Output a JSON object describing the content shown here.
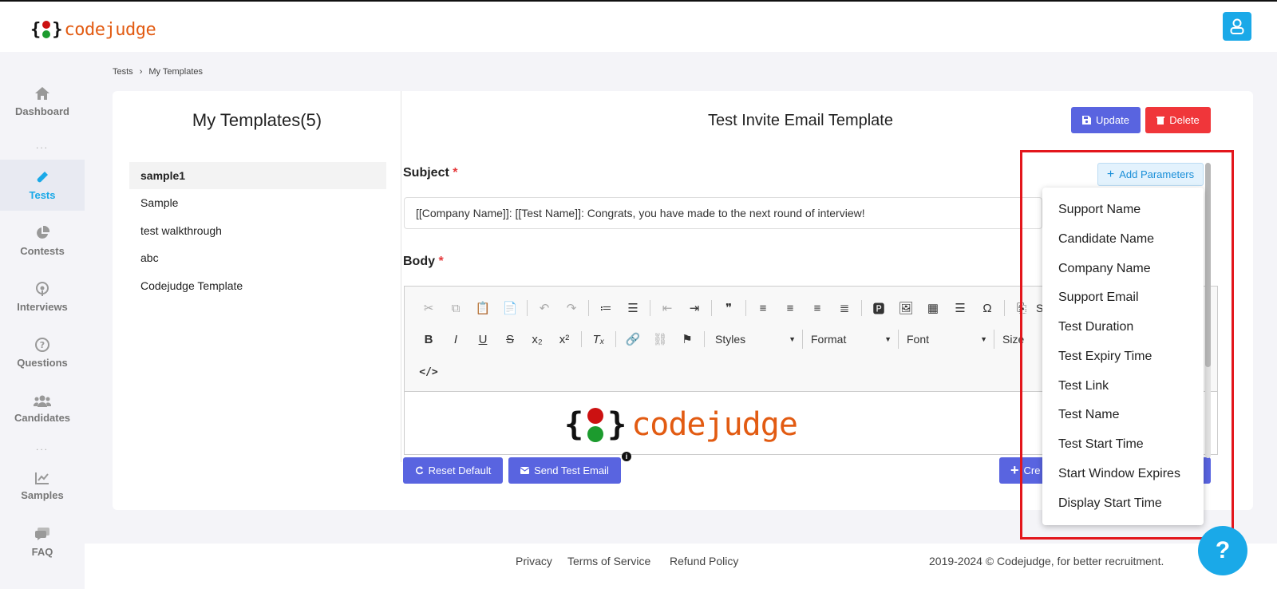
{
  "brand": {
    "name": "codejudge",
    "colors": {
      "accent": "#1aa9e8",
      "brand_orange": "#e25b12",
      "dot_red": "#cc1111",
      "dot_green": "#1c9b2e",
      "primary_button": "#5964e0",
      "danger_button": "#f0363a"
    }
  },
  "sidebar": {
    "items": [
      {
        "label": "Dashboard",
        "icon": "home-icon"
      },
      {
        "label": "Tests",
        "icon": "flask-icon"
      },
      {
        "label": "Contests",
        "icon": "pie-chart-icon"
      },
      {
        "label": "Interviews",
        "icon": "podcast-icon"
      },
      {
        "label": "Questions",
        "icon": "question-circle-icon"
      },
      {
        "label": "Candidates",
        "icon": "users-icon"
      },
      {
        "label": "Samples",
        "icon": "line-chart-icon"
      },
      {
        "label": "FAQ",
        "icon": "chat-icon"
      }
    ],
    "separator": "...",
    "active": "Tests"
  },
  "breadcrumb": {
    "root": "Tests",
    "separator": "›",
    "current": "My Templates"
  },
  "templates": {
    "title": "My Templates(5)",
    "items": [
      "sample1",
      "Sample",
      "test walkthrough",
      "abc",
      "Codejudge Template"
    ],
    "selected": "sample1"
  },
  "editor_panel": {
    "title": "Test Invite Email Template",
    "update_label": "Update",
    "delete_label": "Delete",
    "subject_label": "Subject",
    "required_mark": "*",
    "subject_value": "[[Company Name]]: [[Test Name]]: Congrats, you have made to the next round of interview!",
    "body_label": "Body",
    "toolbar_combos": {
      "styles": "Styles",
      "format": "Format",
      "font": "Font",
      "size": "Size",
      "source": "Sou"
    },
    "reset_label": "Reset Default",
    "send_test_label": "Send Test Email",
    "create_label": "Cre"
  },
  "parameters": {
    "button_label": "Add Parameters",
    "items": [
      "Support Name",
      "Candidate Name",
      "Company Name",
      "Support Email",
      "Test Duration",
      "Test Expiry Time",
      "Test Link",
      "Test Name",
      "Test Start Time",
      "Start Window Expires",
      "Display Start Time"
    ]
  },
  "footer": {
    "links": [
      "Privacy",
      "Terms of Service",
      "Refund Policy"
    ],
    "copyright": "2019-2024 ©  Codejudge, for better recruitment."
  },
  "help_label": "?"
}
